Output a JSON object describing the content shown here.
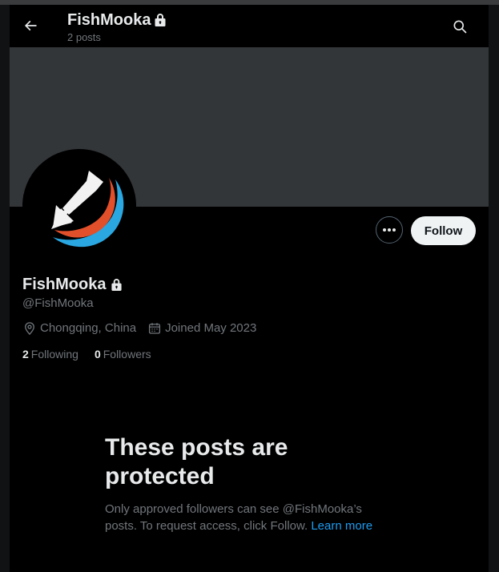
{
  "header": {
    "back_icon": "arrow-left-icon",
    "title": "FishMooka",
    "posts_count": "2 posts",
    "search_icon": "search-icon"
  },
  "profile": {
    "display_name": "FishMooka",
    "handle": "@FishMooka",
    "location": "Chongqing, China",
    "joined": "Joined May 2023",
    "following_count": "2",
    "following_label": "Following",
    "followers_count": "0",
    "followers_label": "Followers",
    "more_icon": "more-icon",
    "follow_label": "Follow",
    "locked_icon": "lock-icon",
    "location_icon": "location-pin-icon",
    "calendar_icon": "calendar-icon"
  },
  "protected": {
    "title": "These posts are protected",
    "body": "Only approved followers can see @FishMooka’s posts. To request access, click Follow.",
    "learn_more": "Learn more"
  },
  "colors": {
    "background": "#000000",
    "banner": "#333639",
    "text_primary": "#e7e9ea",
    "text_secondary": "#71767b",
    "link": "#1d9bf0",
    "follow_button_bg": "#eff3f4",
    "avatar_arc_orange": "#e2502b",
    "avatar_arc_blue": "#2aa7e0"
  }
}
